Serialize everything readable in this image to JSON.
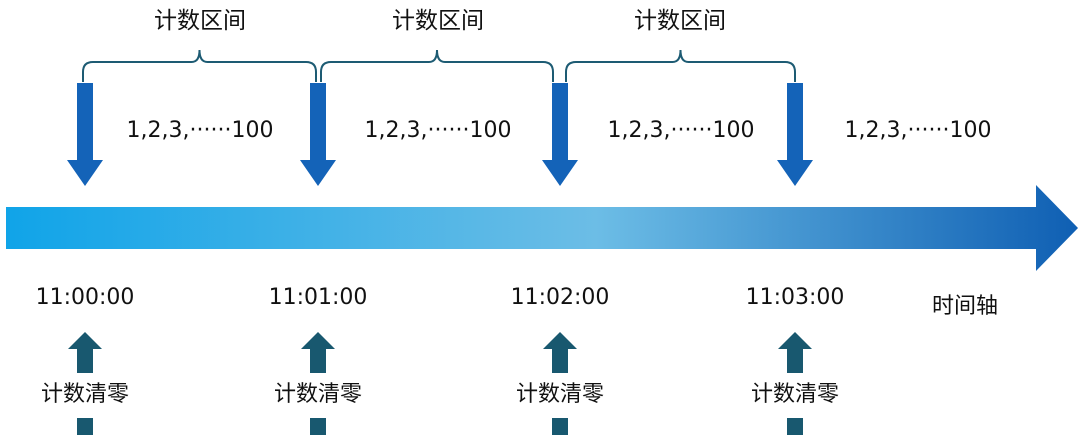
{
  "colors": {
    "bracket": "#1d5b73",
    "down_arrow": "#1463b8",
    "up_arrow": "#18586f",
    "axis_start": "#10a4e8",
    "axis_mid": "#6cbde6",
    "axis_end": "#0f5fb3"
  },
  "intervals": [
    {
      "label": "计数区间"
    },
    {
      "label": "计数区间"
    },
    {
      "label": "计数区间"
    }
  ],
  "sequences": [
    {
      "label": "1,2,3,······100"
    },
    {
      "label": "1,2,3,······100"
    },
    {
      "label": "1,2,3,······100"
    },
    {
      "label": "1,2,3,······100"
    }
  ],
  "times": [
    {
      "label": "11:00:00",
      "reset_label": "计数清零"
    },
    {
      "label": "11:01:00",
      "reset_label": "计数清零"
    },
    {
      "label": "11:02:00",
      "reset_label": "计数清零"
    },
    {
      "label": "11:03:00",
      "reset_label": "计数清零"
    }
  ],
  "axis": {
    "label": "时间轴",
    "icon": "arrow-right-icon"
  }
}
